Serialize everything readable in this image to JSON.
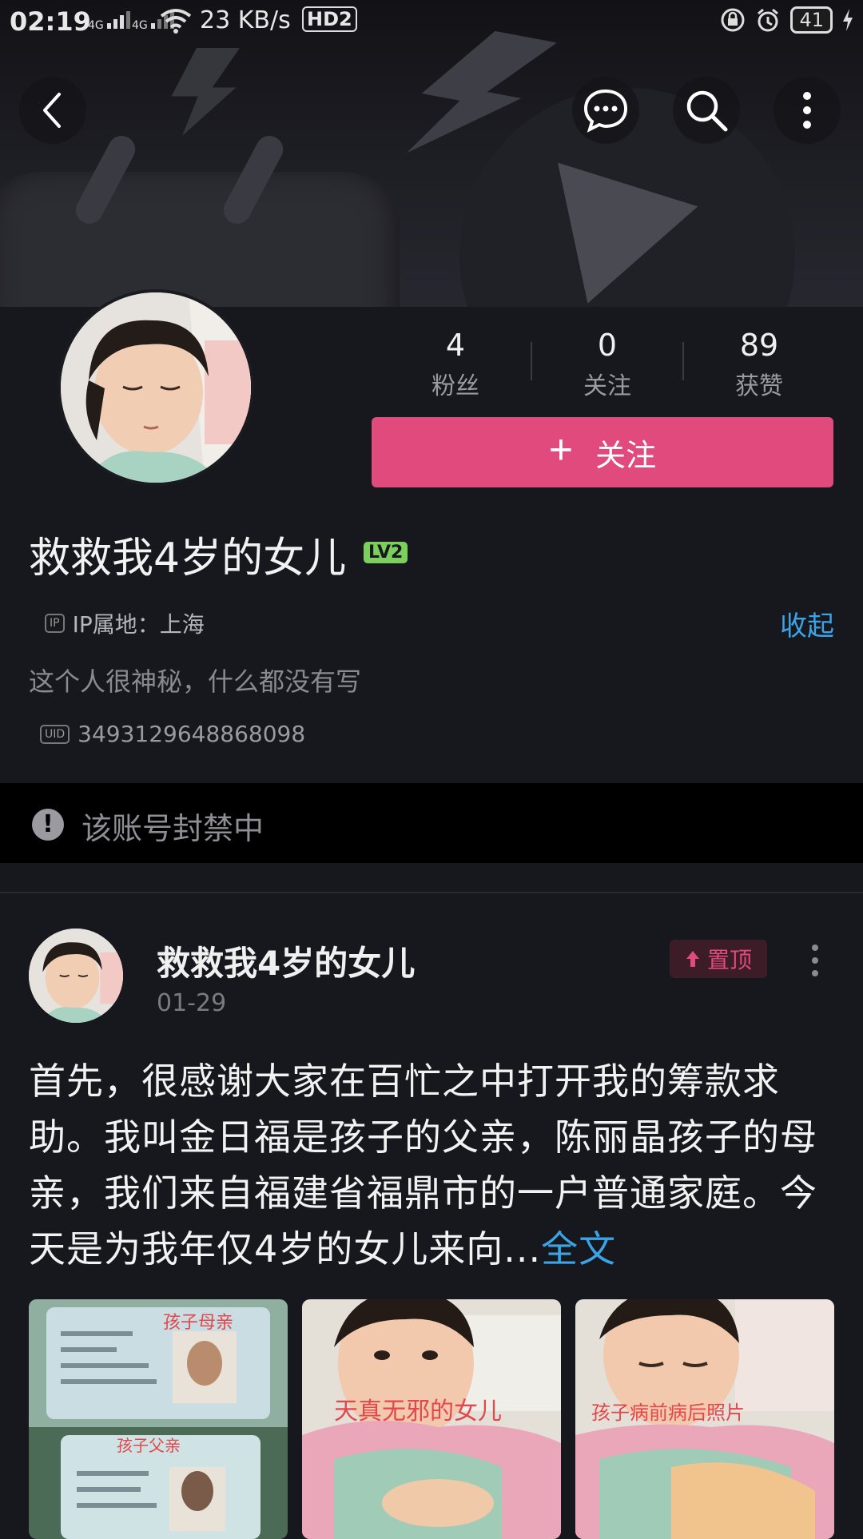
{
  "status_bar": {
    "time": "02:19",
    "signal_1": "4G",
    "signal_2": "4G",
    "net_speed": "23 KB/s",
    "hd": "HD2",
    "battery": "41"
  },
  "profile": {
    "stats": [
      {
        "value": "4",
        "label": "粉丝"
      },
      {
        "value": "0",
        "label": "关注"
      },
      {
        "value": "89",
        "label": "获赞"
      }
    ],
    "follow_label": "关注",
    "username": "救救我4岁的女儿",
    "level_badge": "LV2",
    "ip_tag": "IP",
    "ip_location": "IP属地：上海",
    "collapse_label": "收起",
    "bio": "这个人很神秘，什么都没有写",
    "uid_tag": "UID",
    "uid": "3493129648868098"
  },
  "ban_notice": {
    "icon": "!",
    "text": "该账号封禁中"
  },
  "post": {
    "author": "救救我4岁的女儿",
    "date": "01-29",
    "pinned_label": "置顶",
    "body": "首先，很感谢大家在百忙之中打开我的筹款求助。我叫金日福是孩子的父亲，陈丽晶孩子的母亲，我们来自福建省福鼎市的一户普通家庭。今天是为我年仅4岁的女儿来向...",
    "full_text_link": "全文",
    "images": [
      {
        "caption_top": "孩子母亲",
        "caption_bottom": "孩子父亲"
      },
      {
        "caption": "天真无邪的女儿"
      },
      {
        "caption": "孩子病前病后照片"
      }
    ]
  },
  "colors": {
    "accent_pink": "#e04a7c",
    "link_blue": "#3aa4e6",
    "background": "#17181d"
  }
}
